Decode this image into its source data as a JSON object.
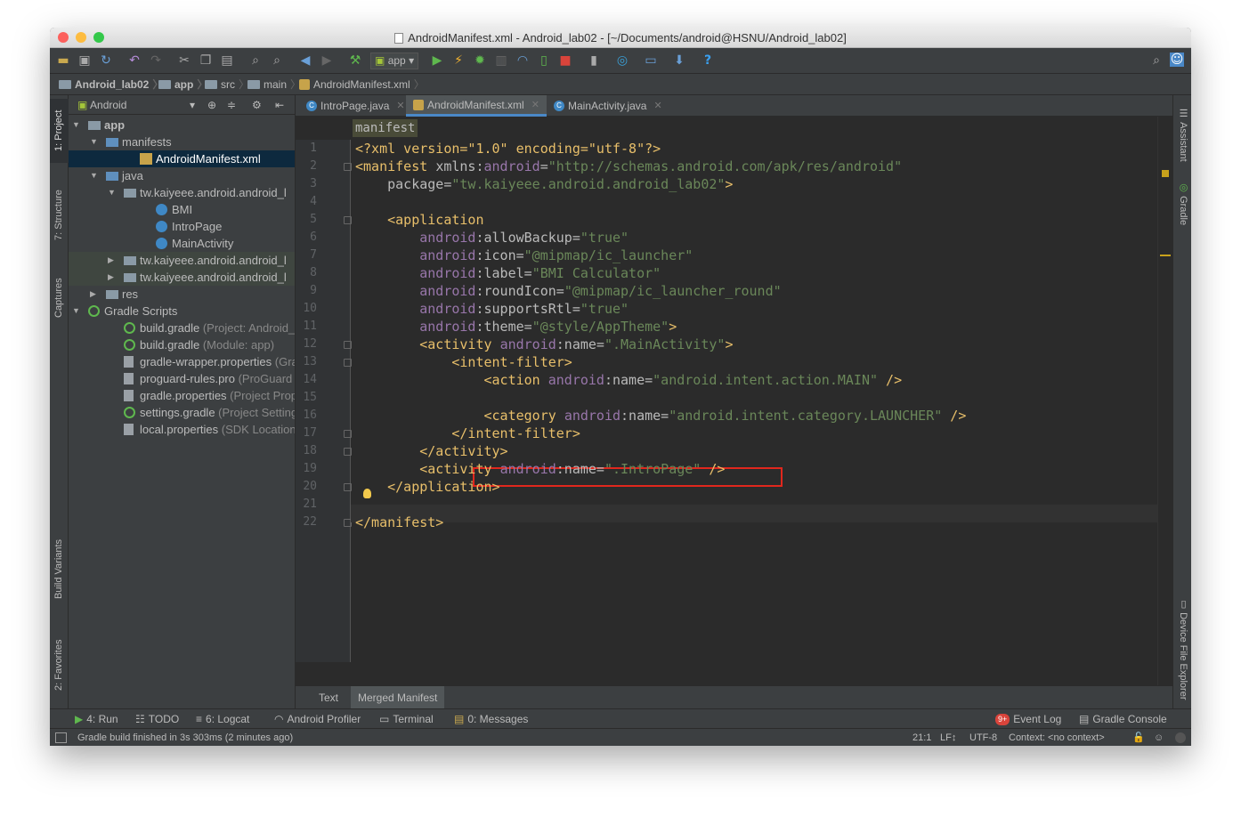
{
  "window": {
    "title": "AndroidManifest.xml - Android_lab02 - [~/Documents/android@HSNU/Android_lab02]"
  },
  "toolbar": {
    "run_config": "app"
  },
  "breadcrumb": [
    "Android_lab02",
    "app",
    "src",
    "main",
    "AndroidManifest.xml"
  ],
  "project_panel": {
    "view_mode": "Android",
    "tree": [
      {
        "label": "app",
        "sub": ""
      },
      {
        "label": "manifests",
        "sub": ""
      },
      {
        "label": "AndroidManifest.xml",
        "sub": ""
      },
      {
        "label": "java",
        "sub": ""
      },
      {
        "label": "tw.kaiyeee.android.android_l",
        "sub": ""
      },
      {
        "label": "BMI",
        "sub": ""
      },
      {
        "label": "IntroPage",
        "sub": ""
      },
      {
        "label": "MainActivity",
        "sub": ""
      },
      {
        "label": "tw.kaiyeee.android.android_l",
        "sub": ""
      },
      {
        "label": "tw.kaiyeee.android.android_l",
        "sub": ""
      },
      {
        "label": "res",
        "sub": ""
      },
      {
        "label": "Gradle Scripts",
        "sub": ""
      },
      {
        "label": "build.gradle",
        "sub": " (Project: Android_la"
      },
      {
        "label": "build.gradle",
        "sub": " (Module: app)"
      },
      {
        "label": "gradle-wrapper.properties",
        "sub": " (Grac"
      },
      {
        "label": "proguard-rules.pro",
        "sub": " (ProGuard R"
      },
      {
        "label": "gradle.properties",
        "sub": " (Project Prope"
      },
      {
        "label": "settings.gradle",
        "sub": " (Project Setting:"
      },
      {
        "label": "local.properties",
        "sub": " (SDK Location)"
      }
    ]
  },
  "left_strip": {
    "project": "1: Project",
    "structure": "7: Structure",
    "captures": "Captures",
    "build_variants": "Build Variants",
    "favorites": "2: Favorites"
  },
  "right_strip": {
    "assistant": "Assistant",
    "gradle": "Gradle",
    "device_file_explorer": "Device File Explorer"
  },
  "editor_tabs": [
    {
      "label": "IntroPage.java"
    },
    {
      "label": "AndroidManifest.xml"
    },
    {
      "label": "MainActivity.java"
    }
  ],
  "editor": {
    "crumb": "manifest",
    "line_numbers": [
      "1",
      "2",
      "3",
      "4",
      "5",
      "6",
      "7",
      "8",
      "9",
      "10",
      "11",
      "12",
      "13",
      "14",
      "15",
      "16",
      "17",
      "18",
      "19",
      "20",
      "21",
      "22"
    ],
    "lines": [
      [
        [
          "t",
          "<?xml version=\"1.0\" encoding=\"utf-8\"?>"
        ]
      ],
      [
        [
          "t",
          "<manifest "
        ],
        [
          "a",
          "xmlns:"
        ],
        [
          "an",
          "android"
        ],
        [
          "a",
          "="
        ],
        [
          "v",
          "\"http://schemas.android.com/apk/res/android\""
        ]
      ],
      [
        [
          "a",
          "    package="
        ],
        [
          "v",
          "\"tw.kaiyeee.android.android_lab02\""
        ],
        [
          "t",
          ">"
        ]
      ],
      [],
      [
        [
          "t",
          "    <application"
        ]
      ],
      [
        [
          "an",
          "        android"
        ],
        [
          "a",
          ":allowBackup="
        ],
        [
          "v",
          "\"true\""
        ]
      ],
      [
        [
          "an",
          "        android"
        ],
        [
          "a",
          ":icon="
        ],
        [
          "v",
          "\"@mipmap/ic_launcher\""
        ]
      ],
      [
        [
          "an",
          "        android"
        ],
        [
          "a",
          ":label="
        ],
        [
          "v",
          "\"BMI Calculator\""
        ]
      ],
      [
        [
          "an",
          "        android"
        ],
        [
          "a",
          ":roundIcon="
        ],
        [
          "v",
          "\"@mipmap/ic_launcher_round\""
        ]
      ],
      [
        [
          "an",
          "        android"
        ],
        [
          "a",
          ":supportsRtl="
        ],
        [
          "v",
          "\"true\""
        ]
      ],
      [
        [
          "an",
          "        android"
        ],
        [
          "a",
          ":theme="
        ],
        [
          "v",
          "\"@style/AppTheme\""
        ],
        [
          "t",
          ">"
        ]
      ],
      [
        [
          "t",
          "        <activity "
        ],
        [
          "an",
          "android"
        ],
        [
          "a",
          ":name="
        ],
        [
          "v",
          "\".MainActivity\""
        ],
        [
          "t",
          ">"
        ]
      ],
      [
        [
          "t",
          "            <intent-filter>"
        ]
      ],
      [
        [
          "t",
          "                <action "
        ],
        [
          "an",
          "android"
        ],
        [
          "a",
          ":name="
        ],
        [
          "v",
          "\"android.intent.action.MAIN\""
        ],
        [
          "t",
          " />"
        ]
      ],
      [],
      [
        [
          "t",
          "                <category "
        ],
        [
          "an",
          "android"
        ],
        [
          "a",
          ":name="
        ],
        [
          "v",
          "\"android.intent.category.LAUNCHER\""
        ],
        [
          "t",
          " />"
        ]
      ],
      [
        [
          "t",
          "            </intent-filter>"
        ]
      ],
      [
        [
          "t",
          "        </activity>"
        ]
      ],
      [
        [
          "t",
          "        <activity "
        ],
        [
          "an",
          "android"
        ],
        [
          "a",
          ":name="
        ],
        [
          "v",
          "\".IntroPage\""
        ],
        [
          "t",
          " />"
        ]
      ],
      [
        [
          "t",
          "    </application>"
        ]
      ],
      [],
      [
        [
          "t",
          "</manifest>"
        ]
      ]
    ]
  },
  "bottom_editor_tabs": [
    "Text",
    "Merged Manifest"
  ],
  "tool_windows": {
    "run": "4: Run",
    "todo": "TODO",
    "logcat": "6: Logcat",
    "profiler": "Android Profiler",
    "terminal": "Terminal",
    "messages": "0: Messages",
    "event_log": "Event Log",
    "event_badge": "9+",
    "gradle_console": "Gradle Console"
  },
  "status": {
    "message": "Gradle build finished in 3s 303ms (2 minutes ago)",
    "position": "21:1",
    "line_sep": "LF↕",
    "encoding": "UTF-8",
    "context": "Context: <no context>"
  }
}
